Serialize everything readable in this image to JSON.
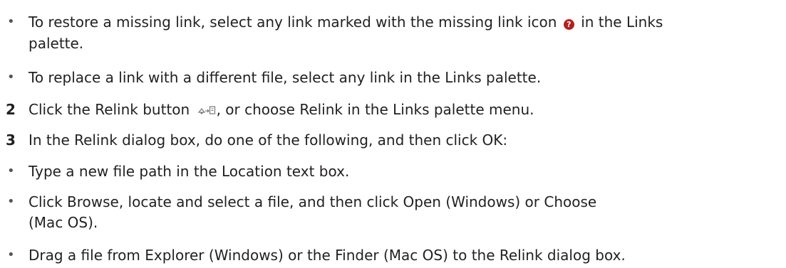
{
  "items": [
    {
      "marker": "•",
      "line1_before_icon": "To restore a missing link, select any link marked with the missing link icon",
      "icon": "missing-link-icon",
      "icon_glyph": "?",
      "line1_after_icon": "in the Links",
      "line2": "palette."
    },
    {
      "marker": "•",
      "text": "To replace a link with a different file, select any link in the Links palette."
    },
    {
      "marker": "2",
      "before_icon": "Click the Relink button",
      "icon": "relink-icon",
      "after_icon": ", or choose Relink in the Links palette menu."
    },
    {
      "marker": "3",
      "text": "In the Relink dialog box, do one of the following, and then click OK:"
    },
    {
      "marker": "•",
      "text": "Type a new file path in the Location text box."
    },
    {
      "marker": "•",
      "line1": "Click Browse, locate and select a file, and then click Open (Windows) or Choose",
      "line2": "(Mac OS)."
    },
    {
      "marker": "•",
      "text": "Drag a file from Explorer (Windows) or the Finder (Mac OS) to the Relink dialog box."
    }
  ],
  "colors": {
    "text": "#231f20",
    "bullet": "#555555",
    "missing_link_icon": "#b5201c"
  }
}
